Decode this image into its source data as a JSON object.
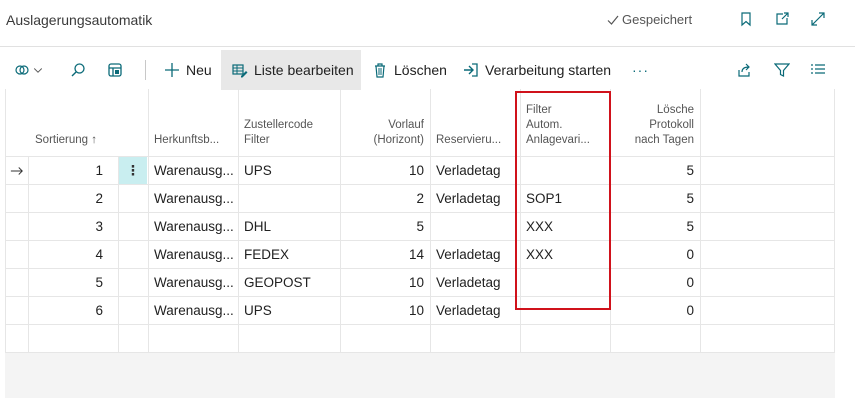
{
  "header": {
    "title": "Auslagerungsautomatik",
    "saved_label": "Gespeichert"
  },
  "toolbar": {
    "new_label": "Neu",
    "edit_list_label": "Liste bearbeiten",
    "delete_label": "Löschen",
    "start_processing_label": "Verarbeitung starten",
    "more_label": "···"
  },
  "columns": {
    "sort": [
      "Sortierung ↑"
    ],
    "origin": [
      "Herkunftsb..."
    ],
    "carrier": [
      "Zustellercode",
      "Filter"
    ],
    "lead": [
      "Vorlauf",
      "(Horizont)"
    ],
    "reserve": [
      "Reservieru..."
    ],
    "filter": [
      "Filter",
      "Autom.",
      "Anlagevari..."
    ],
    "delete_log": [
      "Lösche",
      "Protokoll",
      "nach Tagen"
    ]
  },
  "rows": [
    {
      "sort": "1",
      "origin": "Warenausg...",
      "carrier": "UPS",
      "lead": "10",
      "reserve": "Verladetag",
      "filter": "",
      "days": "5"
    },
    {
      "sort": "2",
      "origin": "Warenausg...",
      "carrier": "",
      "lead": "2",
      "reserve": "Verladetag",
      "filter": "SOP1",
      "days": "5"
    },
    {
      "sort": "3",
      "origin": "Warenausg...",
      "carrier": "DHL",
      "lead": "5",
      "reserve": "",
      "filter": "XXX",
      "days": "5"
    },
    {
      "sort": "4",
      "origin": "Warenausg...",
      "carrier": "FEDEX",
      "lead": "14",
      "reserve": "Verladetag",
      "filter": "XXX",
      "days": "0"
    },
    {
      "sort": "5",
      "origin": "Warenausg...",
      "carrier": "GEOPOST",
      "lead": "10",
      "reserve": "Verladetag",
      "filter": "",
      "days": "0"
    },
    {
      "sort": "6",
      "origin": "Warenausg...",
      "carrier": "UPS",
      "lead": "10",
      "reserve": "Verladetag",
      "filter": "",
      "days": "0"
    }
  ],
  "colors": {
    "highlight": "#d0121b",
    "accent": "#0a6a78",
    "row_menu_bg": "#c9eef0"
  }
}
